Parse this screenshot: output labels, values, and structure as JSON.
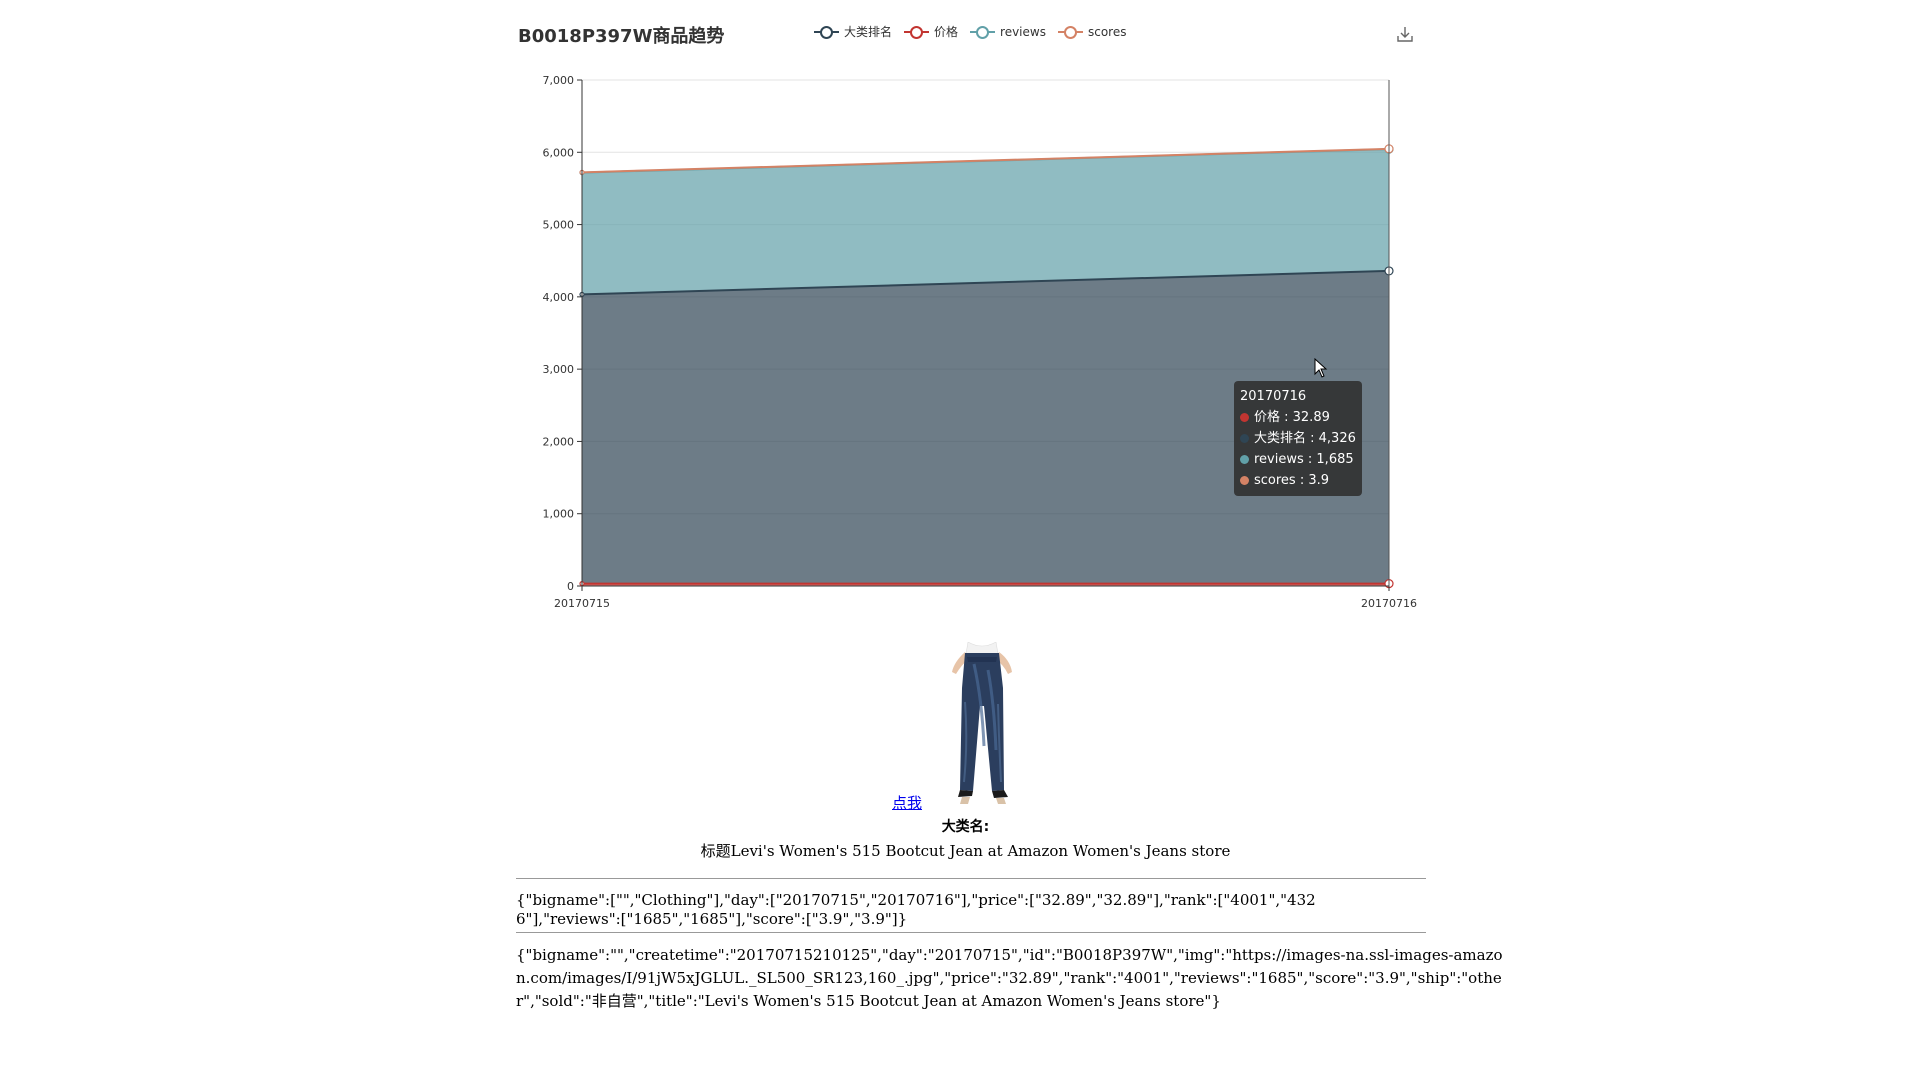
{
  "header": {
    "title": "B0018P397W商品趋势",
    "download_icon": "download-icon"
  },
  "legend": [
    {
      "label": "大类排名",
      "color": "#2f4554"
    },
    {
      "label": "价格",
      "color": "#c23531"
    },
    {
      "label": "reviews",
      "color": "#61a0a8"
    },
    {
      "label": "scores",
      "color": "#d48265"
    }
  ],
  "chart_data": {
    "type": "area",
    "stacked": true,
    "title": "B0018P397W商品趋势",
    "categories": [
      "20170715",
      "20170716"
    ],
    "series": [
      {
        "name": "价格",
        "color": "#c23531",
        "values": [
          32.89,
          32.89
        ]
      },
      {
        "name": "大类排名",
        "color": "#2f4554",
        "values": [
          4001,
          4326
        ]
      },
      {
        "name": "reviews",
        "color": "#61a0a8",
        "values": [
          1685,
          1685
        ]
      },
      {
        "name": "scores",
        "color": "#d48265",
        "values": [
          3.9,
          3.9
        ]
      }
    ],
    "ylim": [
      0,
      7000
    ],
    "yticks": [
      0,
      1000,
      2000,
      3000,
      4000,
      5000,
      6000,
      7000
    ],
    "ytick_labels": [
      "0",
      "1,000",
      "2,000",
      "3,000",
      "4,000",
      "5,000",
      "6,000",
      "7,000"
    ],
    "grid": true,
    "legend_position": "top"
  },
  "tooltip": {
    "date": "20170716",
    "rows": [
      {
        "label": "价格 : 32.89",
        "color": "#c23531"
      },
      {
        "label": "大类排名 : 4,326",
        "color": "#2f4554"
      },
      {
        "label": "reviews : 1,685",
        "color": "#61a0a8"
      },
      {
        "label": "scores : 3.9",
        "color": "#d48265"
      }
    ]
  },
  "product": {
    "link_text": "点我",
    "category_label": "大类名:",
    "title_line": "标题Levi's Women's 515 Bootcut Jean at Amazon Women's Jeans store",
    "image_icon": "jeans-product-image"
  },
  "json_lines": {
    "trend": "{\"bigname\":[\"\",\"Clothing\"],\"day\":[\"20170715\",\"20170716\"],\"price\":[\"32.89\",\"32.89\"],\"rank\":[\"4001\",\"4326\"],\"reviews\":[\"1685\",\"1685\"],\"score\":[\"3.9\",\"3.9\"]}",
    "record": "{\"bigname\":\"\",\"createtime\":\"20170715210125\",\"day\":\"20170715\",\"id\":\"B0018P397W\",\"img\":\"https://images-na.ssl-images-amazon.com/images/I/91jW5xJGLUL._SL500_SR123,160_.jpg\",\"price\":\"32.89\",\"rank\":\"4001\",\"reviews\":\"1685\",\"score\":\"3.9\",\"ship\":\"other\",\"sold\":\"非自营\",\"title\":\"Levi's Women's 515 Bootcut Jean at Amazon Women's Jeans store\"}"
  }
}
